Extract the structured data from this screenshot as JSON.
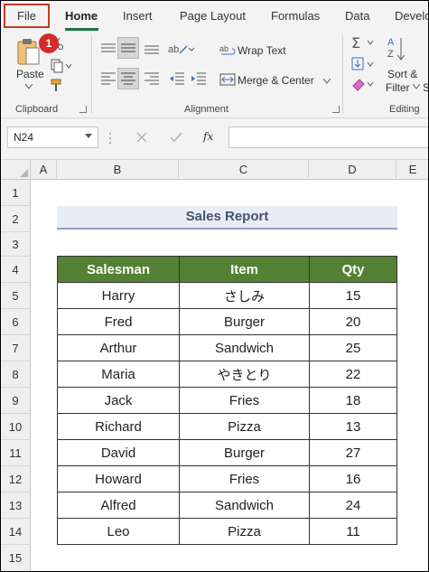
{
  "ribbon": {
    "tabs": [
      "File",
      "Home",
      "Insert",
      "Page Layout",
      "Formulas",
      "Data",
      "Develc"
    ],
    "active_tab": "Home",
    "badge": "1",
    "clipboard": {
      "paste_label": "Paste",
      "group_label": "Clipboard"
    },
    "alignment": {
      "wrap_text": "Wrap Text",
      "merge_center": "Merge & Center",
      "group_label": "Alignment"
    },
    "editing": {
      "sort_label_1": "Sort &",
      "sort_label_2": "Filter",
      "find_partial": "S",
      "group_label": "Editing"
    }
  },
  "formula_bar": {
    "name_box": "N24",
    "fx": "fx",
    "formula": ""
  },
  "grid": {
    "columns": [
      "A",
      "B",
      "C",
      "D",
      "E"
    ],
    "rows": [
      "1",
      "2",
      "3",
      "4",
      "5",
      "6",
      "7",
      "8",
      "9",
      "10",
      "11",
      "12",
      "13",
      "14",
      "15"
    ]
  },
  "report": {
    "title": "Sales Report",
    "headers": [
      "Salesman",
      "Item",
      "Qty"
    ],
    "rows": [
      [
        "Harry",
        "さしみ",
        "15"
      ],
      [
        "Fred",
        "Burger",
        "20"
      ],
      [
        "Arthur",
        "Sandwich",
        "25"
      ],
      [
        "Maria",
        "やきとり",
        "22"
      ],
      [
        "Jack",
        "Fries",
        "18"
      ],
      [
        "Richard",
        "Pizza",
        "13"
      ],
      [
        "David",
        "Burger",
        "27"
      ],
      [
        "Howard",
        "Fries",
        "16"
      ],
      [
        "Alfred",
        "Sandwich",
        "24"
      ],
      [
        "Leo",
        "Pizza",
        "11"
      ]
    ]
  },
  "colors": {
    "header_green": "#548235",
    "title_bg": "#e8ecf4",
    "title_text": "#44546a",
    "accent": "#1e7145",
    "badge_red": "#d72a2a"
  }
}
